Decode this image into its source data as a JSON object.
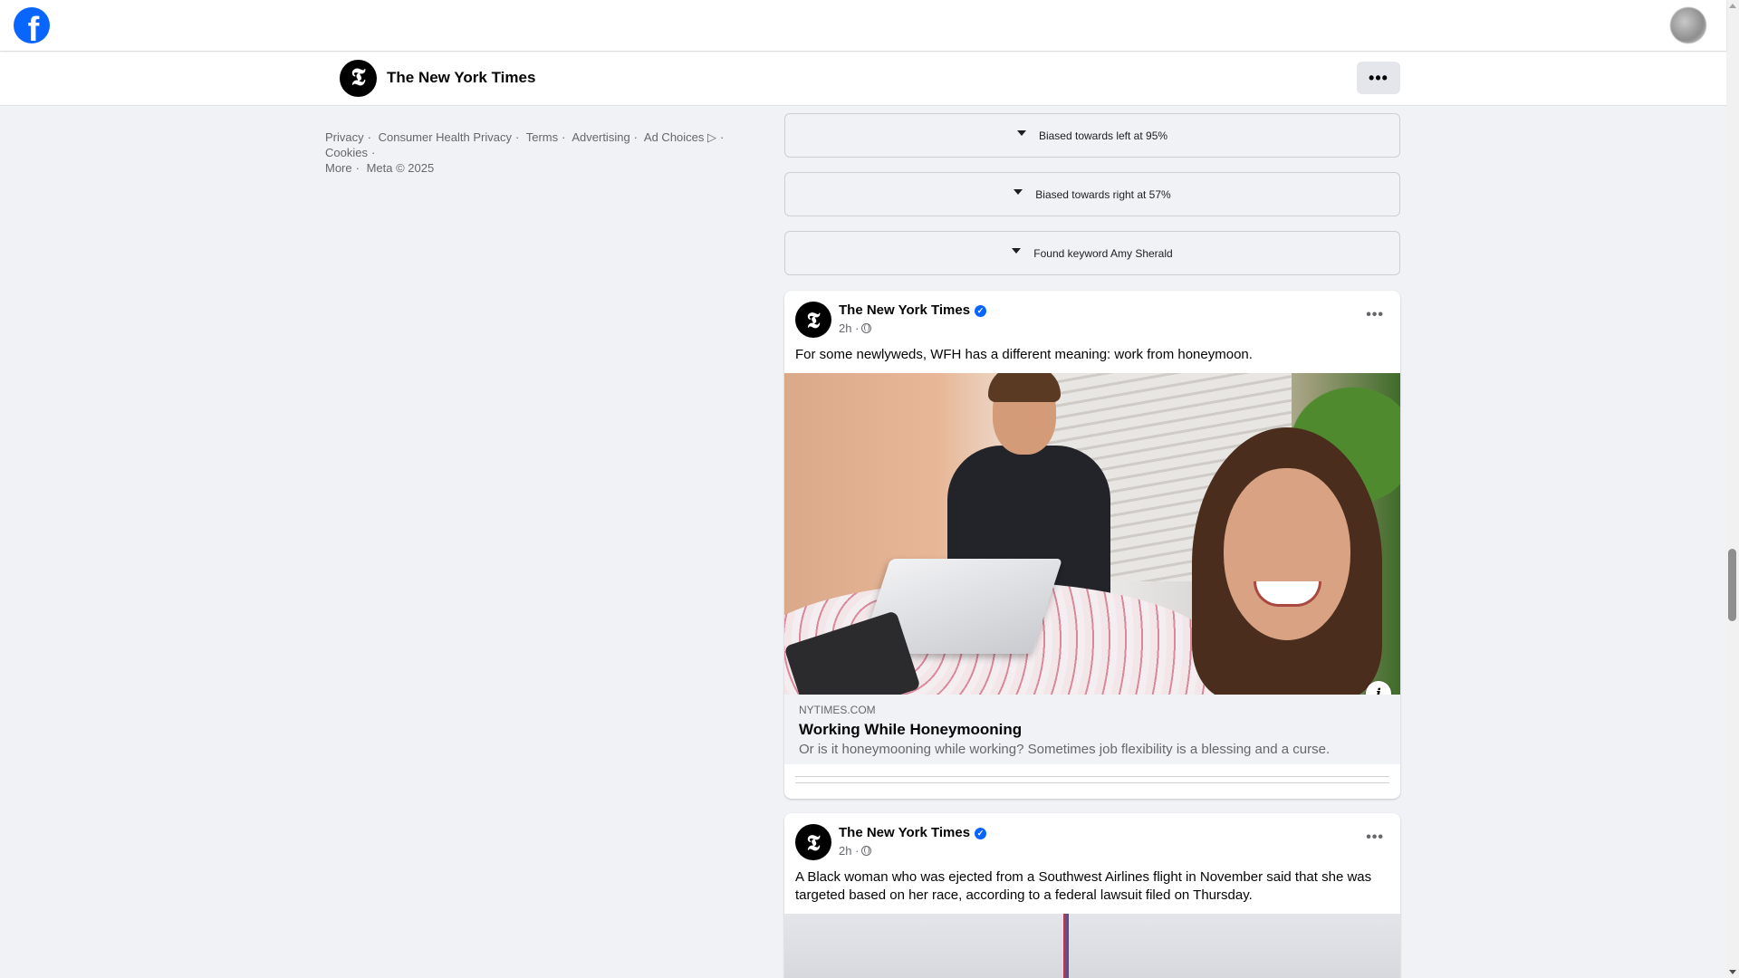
{
  "topbar": {
    "logo_letter": "f",
    "logo_icon": "facebook-logo-icon",
    "profile_icon": "profile-avatar-icon"
  },
  "page_header": {
    "logo_letter": "𝕿",
    "title": "The New York Times",
    "more_label": "•••"
  },
  "footer": {
    "links": [
      "Privacy",
      "·",
      "Consumer Health Privacy",
      "·",
      "Terms",
      "·",
      "Advertising",
      "·",
      "Ad Choices ▷",
      "·",
      "Cookies",
      "·",
      "More",
      "·",
      "Meta © 2025"
    ]
  },
  "filters": [
    {
      "label": "Biased towards left at 95%"
    },
    {
      "label": "Biased towards right at 57%"
    },
    {
      "label": "Found keyword Amy Sherald"
    }
  ],
  "posts": [
    {
      "author": "The New York Times",
      "verified_mark": "✓",
      "time": "2h ·",
      "text": "For some newlyweds, WFH has a different meaning: work from honeymoon.",
      "more_label": "•••",
      "info_label": "i",
      "link": {
        "domain": "NYTIMES.COM",
        "title": "Working While Honeymooning",
        "description": "Or is it honeymooning while working? Sometimes job flexibility is a blessing and a curse."
      }
    },
    {
      "author": "The New York Times",
      "verified_mark": "✓",
      "time": "2h ·",
      "text": "A Black woman who was ejected from a Southwest Airlines flight in November said that she was targeted based on her race, according to a federal lawsuit filed on Thursday.",
      "more_label": "•••"
    }
  ],
  "colors": {
    "facebook_blue": "#0866ff",
    "background": "#f0f2f5",
    "secondary_text": "#65676b"
  }
}
